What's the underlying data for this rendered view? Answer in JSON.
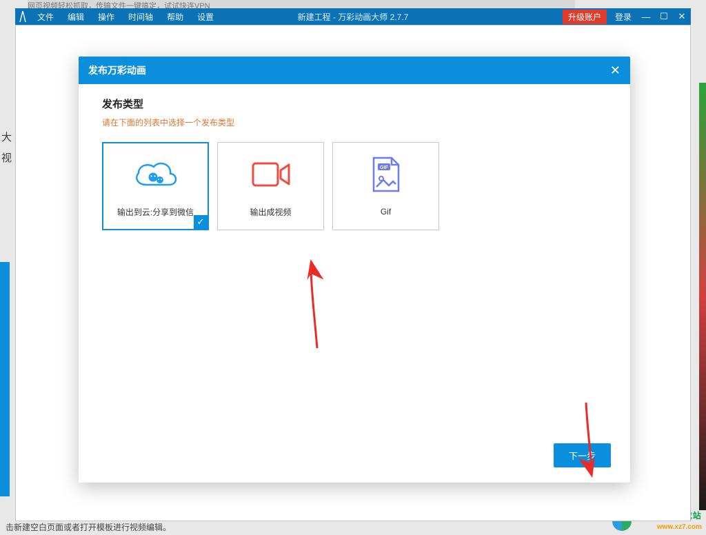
{
  "bg": {
    "blur_text": "网页视频轻松抓取，传输文件一键搞定，试试快连VPN",
    "side_text_1": "大",
    "side_text_2": "视",
    "bottom_text": "击新建空白页面或者打开模板进行视频编辑。"
  },
  "titlebar": {
    "menu": [
      "文件",
      "编辑",
      "操作",
      "时间轴",
      "帮助",
      "设置"
    ],
    "title": "新建工程 - 万彩动画大师 2.7.7",
    "upgrade": "升级账户",
    "login": "登录"
  },
  "dialog": {
    "title": "发布万彩动画",
    "section_title": "发布类型",
    "hint": "请在下面的列表中选择一个发布类型",
    "options": [
      {
        "label": "输出到云:分享到微信",
        "selected": true
      },
      {
        "label": "输出成视频",
        "selected": false
      },
      {
        "label": "Gif",
        "selected": false
      }
    ],
    "next": "下一步"
  },
  "watermark": {
    "line1": "极光下载站",
    "line2": "www.xz7.com"
  }
}
